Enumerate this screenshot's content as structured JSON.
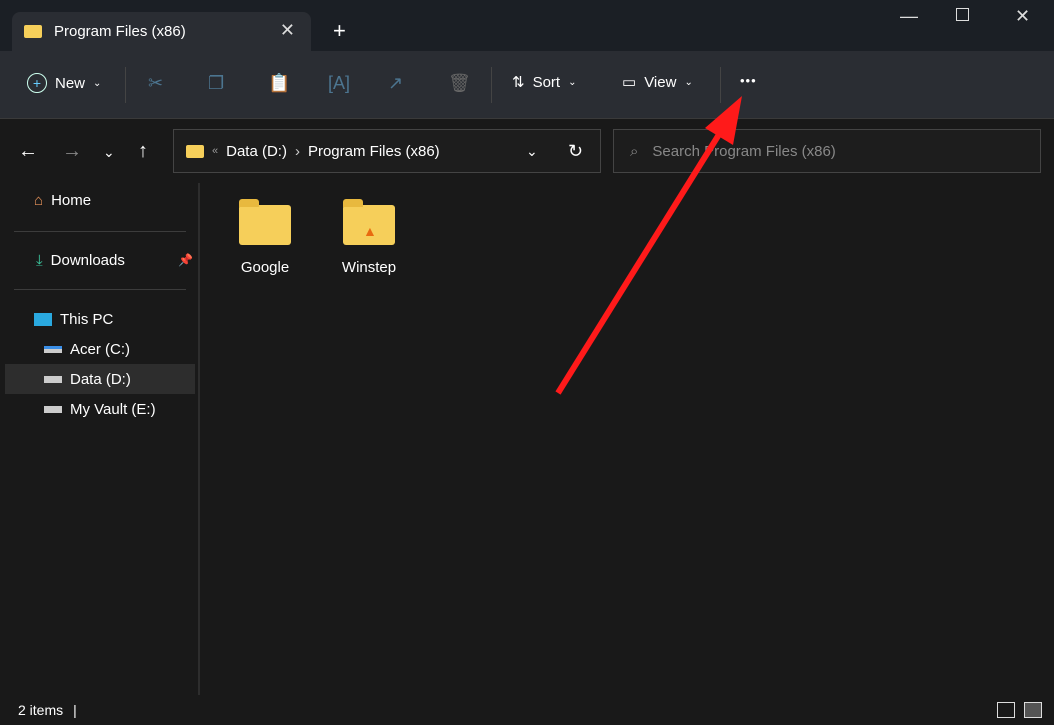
{
  "tab": {
    "title": "Program Files (x86)"
  },
  "toolbar": {
    "new_label": "New",
    "sort_label": "Sort",
    "view_label": "View",
    "more": "•••"
  },
  "address": {
    "segments": [
      "Data (D:)",
      "Program Files (x86)"
    ]
  },
  "search": {
    "placeholder": "Search Program Files (x86)"
  },
  "sidebar": {
    "items": [
      {
        "label": "Home"
      },
      {
        "label": "Downloads"
      },
      {
        "label": "This PC"
      },
      {
        "label": "Acer (C:)"
      },
      {
        "label": "Data (D:)"
      },
      {
        "label": "My Vault (E:)"
      }
    ]
  },
  "files": [
    {
      "name": "Google"
    },
    {
      "name": "Winstep"
    }
  ],
  "status": {
    "count": "2 items"
  },
  "annotation": {
    "color": "#ff1a1a"
  }
}
